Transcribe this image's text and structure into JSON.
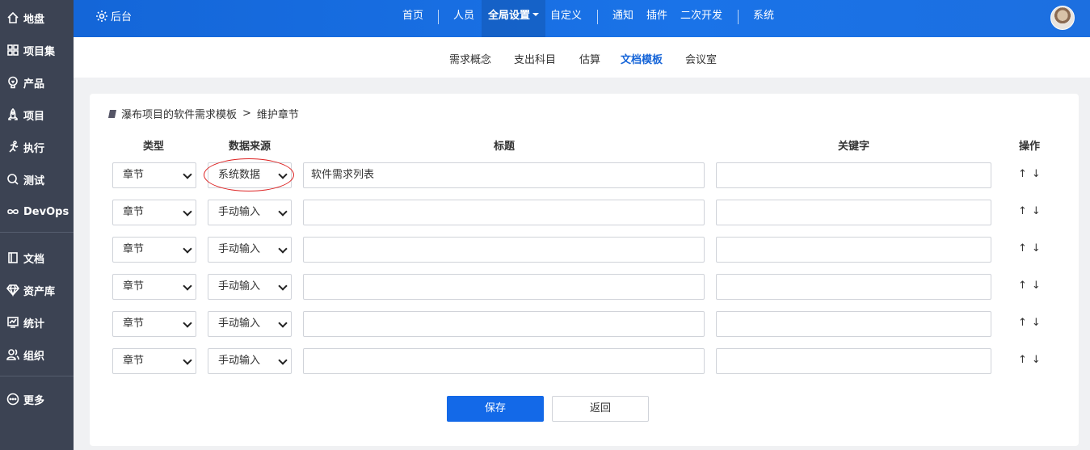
{
  "sidebar": {
    "items": [
      {
        "label": "地盘",
        "icon": "home-icon"
      },
      {
        "label": "项目集",
        "icon": "grid-icon"
      },
      {
        "label": "产品",
        "icon": "bulb-icon"
      },
      {
        "label": "项目",
        "icon": "rocket-icon"
      },
      {
        "label": "执行",
        "icon": "run-icon"
      },
      {
        "label": "测试",
        "icon": "search-icon"
      },
      {
        "label": "DevOps",
        "icon": "infinity-icon"
      },
      {
        "label": "文档",
        "icon": "book-icon"
      },
      {
        "label": "资产库",
        "icon": "diamond-icon"
      },
      {
        "label": "统计",
        "icon": "chart-icon"
      },
      {
        "label": "组织",
        "icon": "people-icon"
      },
      {
        "label": "更多",
        "icon": "more-icon"
      }
    ]
  },
  "header": {
    "backend_label": "后台",
    "nav": [
      "首页",
      "人员",
      "全局设置",
      "自定义",
      "通知",
      "插件",
      "二次开发",
      "系统"
    ],
    "active_nav": "全局设置"
  },
  "subnav": {
    "items": [
      "需求概念",
      "支出科目",
      "估算",
      "文档模板",
      "会议室"
    ],
    "active": "文档模板"
  },
  "breadcrumb": {
    "parent": "瀑布项目的软件需求模板",
    "separator": ">",
    "current": "维护章节"
  },
  "table": {
    "headers": {
      "type": "类型",
      "source": "数据来源",
      "title": "标题",
      "keyword": "关键字",
      "ops": "操作"
    },
    "rows": [
      {
        "type": "章节",
        "source": "系统数据",
        "title": "软件需求列表",
        "keyword": ""
      },
      {
        "type": "章节",
        "source": "手动输入",
        "title": "",
        "keyword": ""
      },
      {
        "type": "章节",
        "source": "手动输入",
        "title": "",
        "keyword": ""
      },
      {
        "type": "章节",
        "source": "手动输入",
        "title": "",
        "keyword": ""
      },
      {
        "type": "章节",
        "source": "手动输入",
        "title": "",
        "keyword": ""
      },
      {
        "type": "章节",
        "source": "手动输入",
        "title": "",
        "keyword": ""
      }
    ],
    "op_up": "↑",
    "op_down": "↓"
  },
  "buttons": {
    "save": "保存",
    "back": "返回"
  },
  "colors": {
    "brand": "#1a73e8",
    "sidebar": "#3c4353",
    "highlight_ring": "#dd2222"
  }
}
